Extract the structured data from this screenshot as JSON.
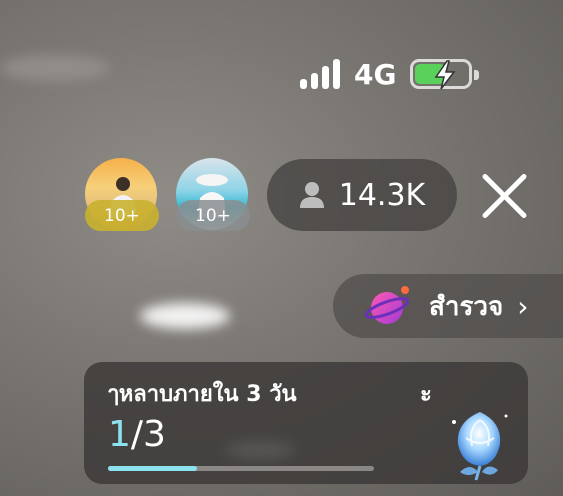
{
  "status_bar": {
    "network": "4G",
    "battery_icon": "battery-charging-icon",
    "battery_color": "#5ad15b"
  },
  "avatars": [
    {
      "badge": "10+",
      "badge_color": "#c9b12f"
    },
    {
      "badge": "10+",
      "badge_color": "#8a8e90"
    }
  ],
  "viewers": {
    "count": "14.3K",
    "icon": "person-icon"
  },
  "explore": {
    "label": "สำรวจ",
    "icon": "planet-icon"
  },
  "task": {
    "title": "ๅหลาบภายใน 3 วัน",
    "title_tail": "ะ",
    "current": "1",
    "total": "/3",
    "progress_fraction": 0.333,
    "accent": "#8ce3ef",
    "reward_icon": "crystal-rose-icon"
  }
}
